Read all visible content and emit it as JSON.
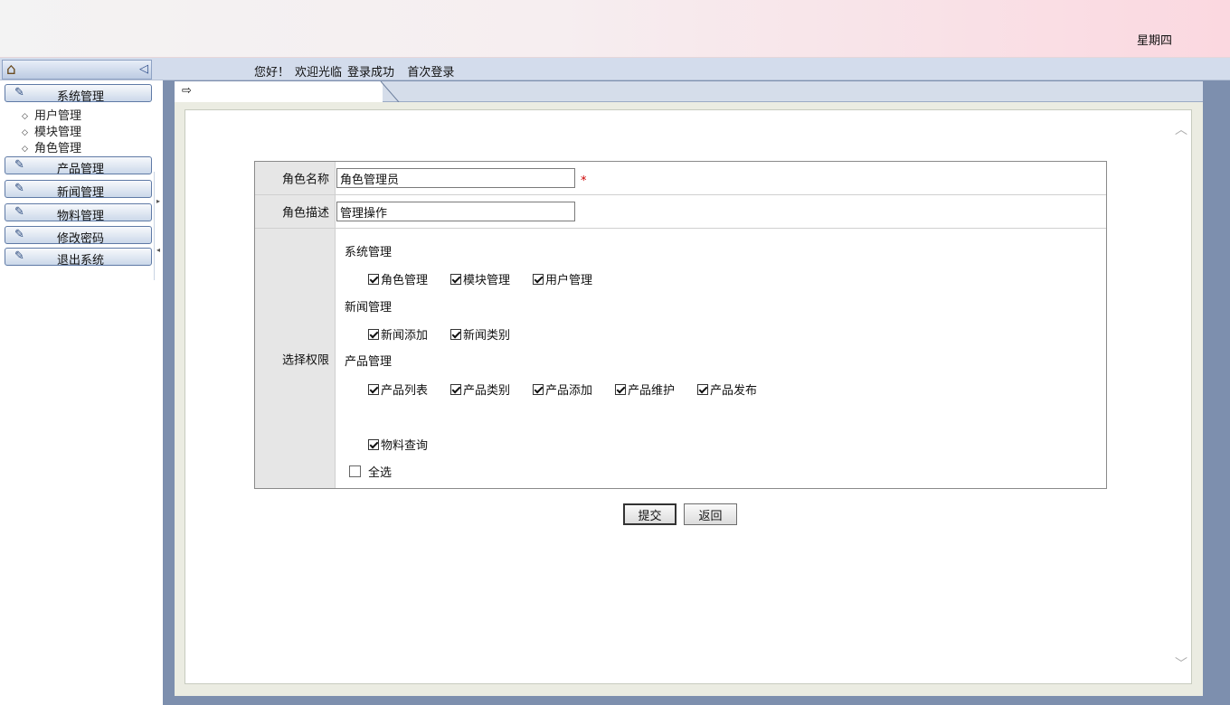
{
  "header": {
    "weekday": "星期四"
  },
  "greeting": {
    "hello": "您好！",
    "welcome": "欢迎光临",
    "status": "登录成功",
    "first_login": "首次登录"
  },
  "sidebar": {
    "menus": [
      {
        "label": "系统管理"
      },
      {
        "label": "产品管理"
      },
      {
        "label": "新闻管理"
      },
      {
        "label": "物料管理"
      },
      {
        "label": "修改密码"
      },
      {
        "label": "退出系统"
      }
    ],
    "subitems": [
      {
        "label": "用户管理"
      },
      {
        "label": "模块管理"
      },
      {
        "label": "角色管理"
      }
    ]
  },
  "form": {
    "role_name_label": "角色名称",
    "role_name_value": "角色管理员",
    "required_mark": "*",
    "role_desc_label": "角色描述",
    "role_desc_value": "管理操作",
    "permission_label": "选择权限",
    "groups": [
      {
        "title": "系统管理",
        "items": [
          "角色管理",
          "模块管理",
          "用户管理"
        ]
      },
      {
        "title": "新闻管理",
        "items": [
          "新闻添加",
          "新闻类别"
        ]
      },
      {
        "title": "产品管理",
        "items": [
          "产品列表",
          "产品类别",
          "产品添加",
          "产品维护",
          "产品发布"
        ]
      }
    ],
    "material_item": "物料查询",
    "select_all": "全选"
  },
  "buttons": {
    "submit": "提交",
    "back": "返回"
  }
}
